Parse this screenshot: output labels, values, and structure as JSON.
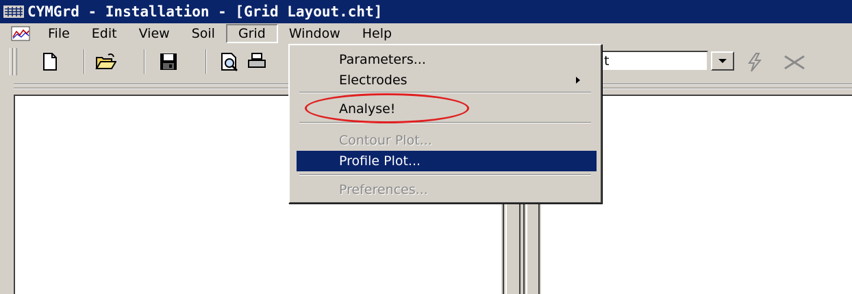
{
  "window": {
    "title": "CYMGrd - Installation - [Grid Layout.cht]",
    "title_bar_color": "#0a246a",
    "app_icon": "cymgrd-app-icon"
  },
  "menubar": {
    "doc_icon": "chart-document-icon",
    "items": [
      {
        "label": "File"
      },
      {
        "label": "Edit"
      },
      {
        "label": "View"
      },
      {
        "label": "Soil"
      },
      {
        "label": "Grid",
        "active": true
      },
      {
        "label": "Window"
      },
      {
        "label": "Help"
      }
    ]
  },
  "toolbar": {
    "buttons": [
      "new-document-icon",
      "open-folder-icon",
      "save-disk-icon",
      "print-preview-icon",
      "print-icon"
    ],
    "combo_value": "t",
    "combo_arrow": "dropdown-arrow-icon",
    "disabled_icons": [
      "lightning-icon",
      "close-x-icon"
    ]
  },
  "grid_menu": {
    "items": [
      {
        "label": "Parameters...",
        "state": "enabled"
      },
      {
        "label": "Electrodes",
        "state": "enabled",
        "submenu": true
      },
      {
        "label": "Analyse!",
        "state": "enabled",
        "annotated": true
      },
      {
        "label": "Contour Plot...",
        "state": "disabled"
      },
      {
        "label": "Profile Plot...",
        "state": "highlighted"
      },
      {
        "label": "Preferences...",
        "state": "disabled"
      }
    ],
    "highlight_color": "#0a246a",
    "annotation_color": "#e02020"
  }
}
